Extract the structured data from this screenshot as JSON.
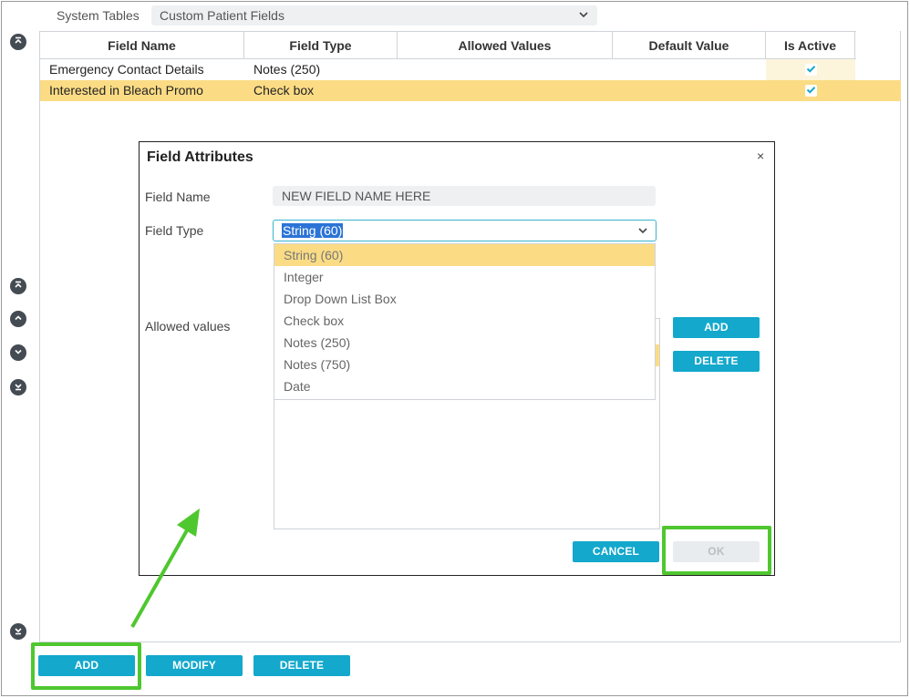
{
  "header": {
    "system_tables_label": "System Tables",
    "table_select_value": "Custom Patient Fields"
  },
  "table": {
    "columns": [
      "Field Name",
      "Field Type",
      "Allowed Values",
      "Default Value",
      "Is Active"
    ],
    "rows": [
      {
        "field_name": "Emergency Contact Details",
        "field_type": "Notes (250)",
        "allowed_values": "",
        "default_value": "",
        "is_active": true,
        "selected": false
      },
      {
        "field_name": "Interested in Bleach Promo",
        "field_type": "Check box",
        "allowed_values": "",
        "default_value": "",
        "is_active": true,
        "selected": true
      }
    ]
  },
  "dialog": {
    "title": "Field Attributes",
    "close_glyph": "×",
    "field_name_label": "Field Name",
    "field_name_placeholder": "NEW FIELD NAME HERE",
    "field_type_label": "Field Type",
    "field_type_value": "String (60)",
    "field_type_options": [
      "String (60)",
      "Integer",
      "Drop Down List Box",
      "Check box",
      "Notes (250)",
      "Notes (750)",
      "Date"
    ],
    "allowed_values_label": "Allowed values",
    "add_label": "ADD",
    "delete_label": "DELETE",
    "cancel_label": "CANCEL",
    "ok_label": "OK"
  },
  "footer": {
    "add_label": "ADD",
    "modify_label": "MODIFY",
    "delete_label": "DELETE"
  },
  "colors": {
    "accent": "#13a8cc",
    "selection": "#fbdc85",
    "highlight_annotation": "#4fc72f",
    "nav_button": "#444b52"
  },
  "icons": [
    "chevron-down-icon",
    "move-top-icon",
    "move-up-icon",
    "move-down-icon",
    "move-bottom-icon",
    "checkmark-icon",
    "close-icon",
    "annotation-arrow-icon"
  ]
}
